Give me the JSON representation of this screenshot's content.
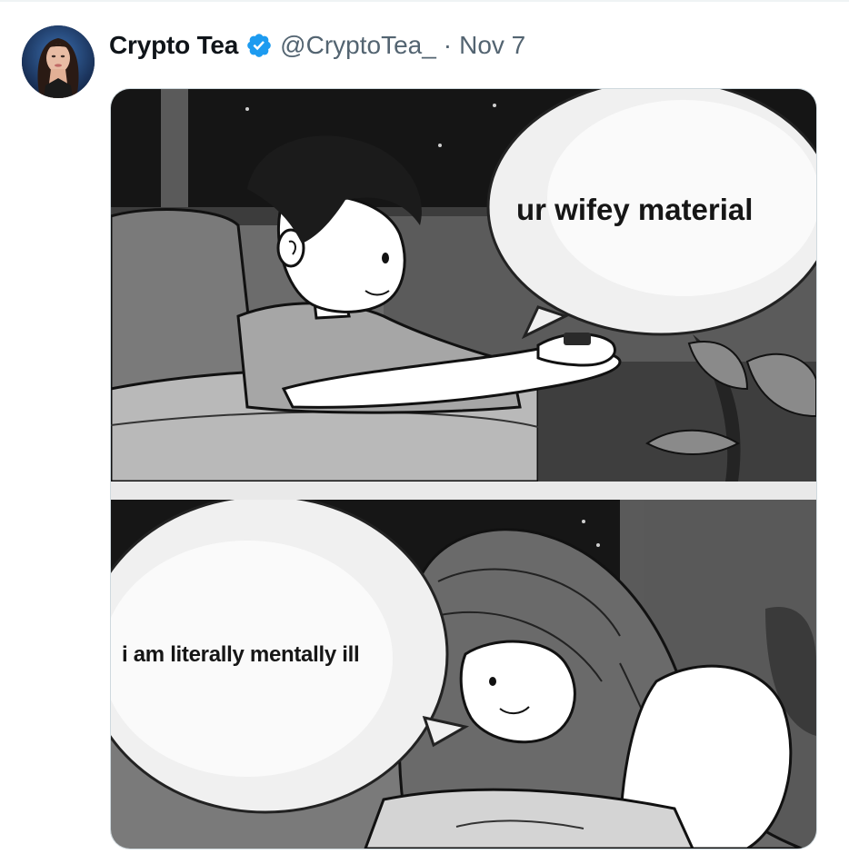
{
  "tweet": {
    "author": {
      "display_name": "Crypto Tea",
      "handle": "@CryptoTea_",
      "verified": true,
      "avatar_icon": "profile-photo"
    },
    "separator": "·",
    "date": "Nov 7",
    "media": {
      "panels": [
        {
          "speech_text": "ur wifey material"
        },
        {
          "speech_text": "i am literally mentally ill"
        }
      ]
    }
  },
  "colors": {
    "verified_blue": "#1d9bf0",
    "name_text": "#0f1419",
    "secondary_text": "#536471",
    "media_border": "#cfd9de"
  }
}
